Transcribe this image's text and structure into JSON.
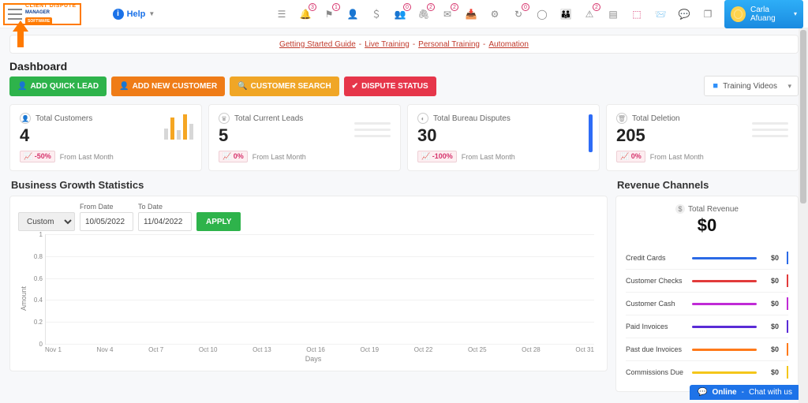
{
  "header": {
    "logo_line1": "CLIENT DISPUTE",
    "logo_line2": "MANAGER",
    "logo_line3": "SOFTWARE",
    "help_label": "Help",
    "badges": {
      "bell": "3",
      "flag": "1",
      "people": "0",
      "graph": "2",
      "mailopen": "2",
      "clock": "0",
      "warn": "2"
    },
    "user_name": "Carla Afuang"
  },
  "quick_links": {
    "l1": "Getting Started Guide",
    "l2": "Live Training",
    "l3": "Personal Training",
    "l4": "Automation"
  },
  "page_title": "Dashboard",
  "buttons": {
    "add_lead": "ADD QUICK LEAD",
    "add_customer": "ADD NEW CUSTOMER",
    "customer_search": "CUSTOMER SEARCH",
    "dispute_status": "DISPUTE STATUS",
    "training_videos": "Training Videos"
  },
  "stats": {
    "customers": {
      "title": "Total Customers",
      "value": "4",
      "delta": "-50%",
      "note": "From Last Month"
    },
    "leads": {
      "title": "Total Current Leads",
      "value": "5",
      "delta": "0%",
      "note": "From Last Month"
    },
    "bureau": {
      "title": "Total Bureau Disputes",
      "value": "30",
      "delta": "-100%",
      "note": "From Last Month"
    },
    "deletion": {
      "title": "Total Deletion",
      "value": "205",
      "delta": "0%",
      "note": "From Last Month"
    }
  },
  "growth": {
    "heading": "Business Growth Statistics",
    "range_label": "Custom",
    "from_label": "From Date",
    "to_label": "To Date",
    "from": "10/05/2022",
    "to": "11/04/2022",
    "apply": "APPLY",
    "ylabel": "Amount",
    "xlabel": "Days"
  },
  "revenue": {
    "heading": "Revenue Channels",
    "total_label": "Total Revenue",
    "total_value": "$0",
    "channels": {
      "credit": {
        "name": "Credit Cards",
        "value": "$0",
        "color": "#2b6ae6"
      },
      "checks": {
        "name": "Customer Checks",
        "value": "$0",
        "color": "#e23b3b"
      },
      "cash": {
        "name": "Customer Cash",
        "value": "$0",
        "color": "#c02bd6"
      },
      "paid": {
        "name": "Paid Invoices",
        "value": "$0",
        "color": "#5a2bd6"
      },
      "pastdue": {
        "name": "Past due Invoices",
        "value": "$0",
        "color": "#ff7a1a"
      },
      "comm": {
        "name": "Commissions Due",
        "value": "$0",
        "color": "#f4c61a"
      }
    }
  },
  "chat": {
    "status": "Online",
    "text": "Chat with us"
  },
  "chart_data": {
    "type": "line",
    "title": "Business Growth Statistics",
    "xlabel": "Days",
    "ylabel": "Amount",
    "ylim": [
      0,
      1
    ],
    "yticks": [
      0,
      0.2,
      0.4,
      0.6,
      0.8,
      1
    ],
    "categories": [
      "Nov 1",
      "Nov 4",
      "Oct 7",
      "Oct 10",
      "Oct 13",
      "Oct 16",
      "Oct 19",
      "Oct 22",
      "Oct 25",
      "Oct 28",
      "Oct 31"
    ],
    "series": [
      {
        "name": "Amount",
        "values": [
          0,
          0,
          0,
          0,
          0,
          0,
          0,
          0,
          0,
          0,
          0
        ]
      }
    ]
  }
}
